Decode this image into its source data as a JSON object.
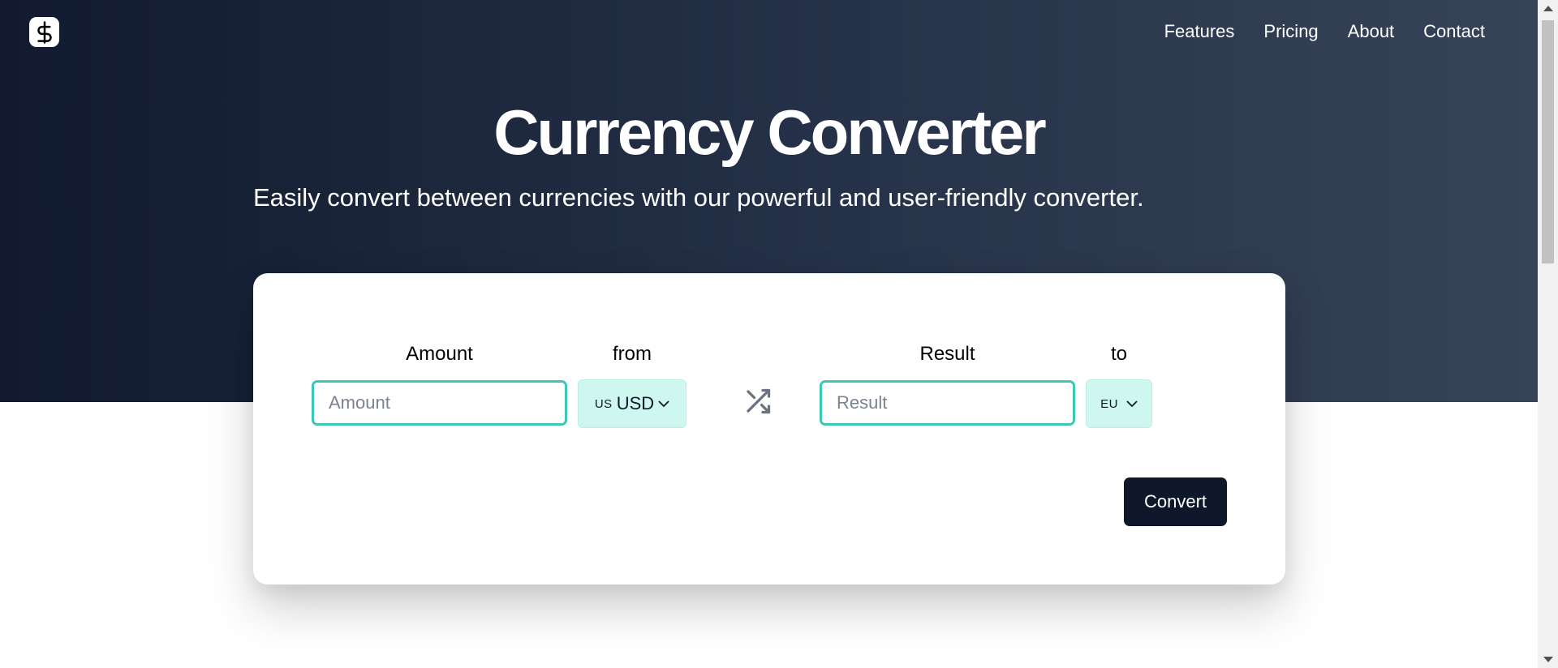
{
  "header": {
    "logo_icon": "dollar-icon",
    "nav": [
      "Features",
      "Pricing",
      "About",
      "Contact"
    ]
  },
  "hero": {
    "title": "Currency Converter",
    "subtitle": "Easily convert between currencies with our powerful and user-friendly converter."
  },
  "converter": {
    "amount": {
      "label": "Amount",
      "placeholder": "Amount",
      "value": ""
    },
    "from": {
      "label": "from",
      "flag": "US",
      "code": "USD"
    },
    "swap_icon": "shuffle-icon",
    "result": {
      "label": "Result",
      "placeholder": "Result",
      "value": ""
    },
    "to": {
      "label": "to",
      "flag": "EU",
      "code": ""
    },
    "convert_label": "Convert"
  },
  "colors": {
    "hero_start": "#111a2e",
    "hero_end": "#374357",
    "input_border": "#3cc7b7",
    "select_bg": "#cdf7ef",
    "button_bg": "#0f172a"
  }
}
